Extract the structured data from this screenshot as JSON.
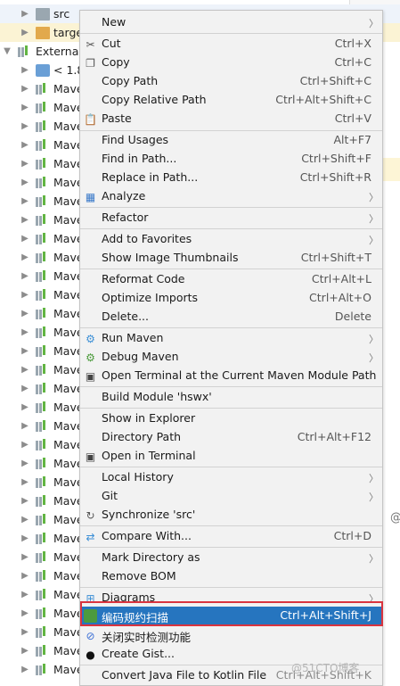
{
  "tree": {
    "rows": [
      {
        "text": "src",
        "icon": "folder-icon"
      },
      {
        "text": "targe",
        "icon": "folder-icon"
      },
      {
        "text": "External",
        "icon": "library-icon"
      },
      {
        "text": "< 1.8",
        "icon": "jdk-icon"
      },
      {
        "text": "Mave"
      },
      {
        "text": "Mave"
      },
      {
        "text": "Mave"
      },
      {
        "text": "Mave"
      },
      {
        "text": "Mave"
      },
      {
        "text": "Mave"
      },
      {
        "text": "Mave"
      },
      {
        "text": "Mave"
      },
      {
        "text": "Mave"
      },
      {
        "text": "Mave"
      },
      {
        "text": "Mave"
      },
      {
        "text": "Mave"
      },
      {
        "text": "Mave"
      },
      {
        "text": "Mave"
      },
      {
        "text": "Mave"
      },
      {
        "text": "Mave"
      },
      {
        "text": "Mave"
      },
      {
        "text": "Mave"
      },
      {
        "text": "Mave"
      },
      {
        "text": "Mave"
      },
      {
        "text": "Mave"
      },
      {
        "text": "Mave"
      },
      {
        "text": "Mave"
      },
      {
        "text": "Mave"
      },
      {
        "text": "Mave"
      },
      {
        "text": "Mave"
      },
      {
        "text": "Mave"
      },
      {
        "text": "Mave"
      },
      {
        "text": "Mave"
      },
      {
        "text": "Mave"
      },
      {
        "text": "Mave"
      },
      {
        "text": "Mave"
      }
    ],
    "right_symbol": "@"
  },
  "menu": {
    "new": {
      "label": "New"
    },
    "cut": {
      "label": "Cut",
      "shortcut": "Ctrl+X"
    },
    "copy": {
      "label": "Copy",
      "shortcut": "Ctrl+C"
    },
    "copy_path": {
      "label": "Copy Path",
      "shortcut": "Ctrl+Shift+C"
    },
    "copy_relative_path": {
      "label": "Copy Relative Path",
      "shortcut": "Ctrl+Alt+Shift+C"
    },
    "paste": {
      "label": "Paste",
      "shortcut": "Ctrl+V"
    },
    "find_usages": {
      "label": "Find Usages",
      "shortcut": "Alt+F7"
    },
    "find_in_path": {
      "label": "Find in Path...",
      "shortcut": "Ctrl+Shift+F"
    },
    "replace_in_path": {
      "label": "Replace in Path...",
      "shortcut": "Ctrl+Shift+R"
    },
    "analyze": {
      "label": "Analyze"
    },
    "refactor": {
      "label": "Refactor"
    },
    "add_to_favorites": {
      "label": "Add to Favorites"
    },
    "show_image_thumbnails": {
      "label": "Show Image Thumbnails",
      "shortcut": "Ctrl+Shift+T"
    },
    "reformat_code": {
      "label": "Reformat Code",
      "shortcut": "Ctrl+Alt+L"
    },
    "optimize_imports": {
      "label": "Optimize Imports",
      "shortcut": "Ctrl+Alt+O"
    },
    "delete": {
      "label": "Delete...",
      "shortcut": "Delete"
    },
    "run_maven": {
      "label": "Run Maven"
    },
    "debug_maven": {
      "label": "Debug Maven"
    },
    "open_terminal_maven": {
      "label": "Open Terminal at the Current Maven Module Path"
    },
    "build_module": {
      "label": "Build Module 'hswx'"
    },
    "show_in_explorer": {
      "label": "Show in Explorer"
    },
    "directory_path": {
      "label": "Directory Path",
      "shortcut": "Ctrl+Alt+F12"
    },
    "open_in_terminal": {
      "label": "Open in Terminal"
    },
    "local_history": {
      "label": "Local History"
    },
    "git": {
      "label": "Git"
    },
    "synchronize": {
      "label": "Synchronize 'src'"
    },
    "compare_with": {
      "label": "Compare With...",
      "shortcut": "Ctrl+D"
    },
    "mark_directory_as": {
      "label": "Mark Directory as"
    },
    "remove_bom": {
      "label": "Remove BOM"
    },
    "diagrams": {
      "label": "Diagrams"
    },
    "code_scan": {
      "label": "编码规约扫描",
      "shortcut": "Ctrl+Alt+Shift+J"
    },
    "close_realtime_check": {
      "label": "关闭实时检测功能"
    },
    "create_gist": {
      "label": "Create Gist..."
    },
    "convert_java_kotlin": {
      "label": "Convert Java File to Kotlin File",
      "shortcut": "Ctrl+Alt+Shift+K"
    }
  },
  "colors": {
    "highlight": "#2675bf",
    "annotation_box": "#d9343f"
  },
  "watermark": "@51CTO博客"
}
